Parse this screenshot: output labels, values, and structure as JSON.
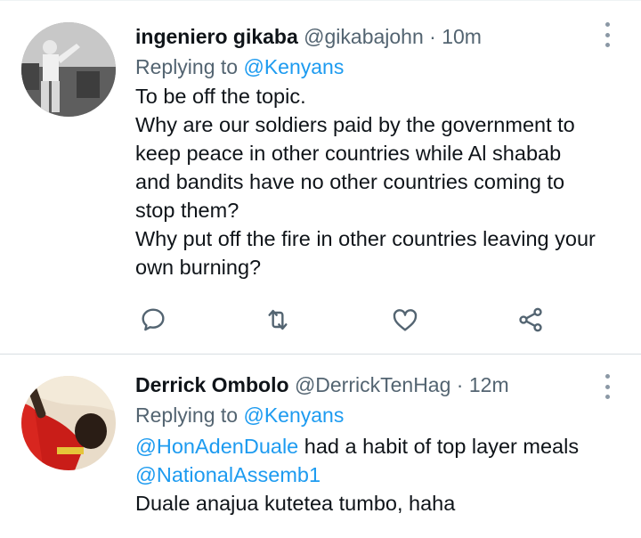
{
  "tweets": [
    {
      "display_name": "ingeniero gikaba",
      "handle": "@gikabajohn",
      "separator": "·",
      "time": "10m",
      "replying_prefix": "Replying to",
      "replying_to": "@Kenyans",
      "lines": [
        "To be off the topic.",
        "Why are our soldiers paid by the government to",
        "keep peace in other countries while Al shabab",
        "and bandits have no other countries coming to",
        "stop them?",
        "Why put off the fire in other countries leaving your",
        "own burning?"
      ],
      "actions": [
        "reply-icon",
        "retweet-icon",
        "like-icon",
        "share-icon"
      ]
    },
    {
      "display_name": "Derrick Ombolo",
      "handle": "@DerrickTenHag",
      "separator": "·",
      "time": "12m",
      "replying_prefix": "Replying to",
      "replying_to": "@Kenyans",
      "mention1": "@HonAdenDuale",
      "line1_rest": " had a habit of top layer meals",
      "mention2": "@NationalAssemb1",
      "line3": "Duale anajua kutetea tumbo, haha"
    }
  ],
  "colors": {
    "link": "#1d9bf0",
    "muted": "#536471",
    "text": "#0f1419"
  }
}
